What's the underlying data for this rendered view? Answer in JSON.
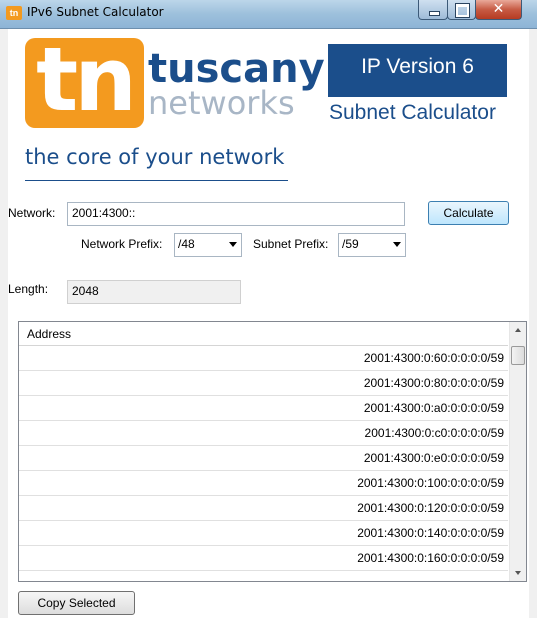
{
  "window": {
    "title": "IPv6 Subnet Calculator",
    "icon_text": "tn",
    "close_glyph": "✕"
  },
  "branding": {
    "logo_text": "tn",
    "company_line1": "tuscany",
    "company_line2": "networks",
    "tagline": "the core of your network",
    "heading1": "IP Version 6",
    "heading2": "Subnet Calculator"
  },
  "form": {
    "network_label": "Network:",
    "network_value": "2001:4300::",
    "calculate_label": "Calculate",
    "network_prefix_label": "Network Prefix:",
    "network_prefix_value": "/48",
    "subnet_prefix_label": "Subnet Prefix:",
    "subnet_prefix_value": "/59",
    "length_label": "Length:",
    "length_value": "2048"
  },
  "list": {
    "column_header": "Address",
    "rows": [
      "2001:4300:0:60:0:0:0:0/59",
      "2001:4300:0:80:0:0:0:0/59",
      "2001:4300:0:a0:0:0:0:0/59",
      "2001:4300:0:c0:0:0:0:0/59",
      "2001:4300:0:e0:0:0:0:0/59",
      "2001:4300:0:100:0:0:0:0/59",
      "2001:4300:0:120:0:0:0:0/59",
      "2001:4300:0:140:0:0:0:0/59",
      "2001:4300:0:160:0:0:0:0/59"
    ]
  },
  "actions": {
    "copy_selected_label": "Copy Selected"
  },
  "colors": {
    "brand_blue": "#1b4e8b",
    "brand_orange": "#f39a1f",
    "brand_grey": "#a8b6c6"
  },
  "icons": [
    "minimize-icon",
    "maximize-icon",
    "close-icon",
    "dropdown-arrow-icon",
    "scroll-up-icon",
    "scroll-down-icon"
  ]
}
